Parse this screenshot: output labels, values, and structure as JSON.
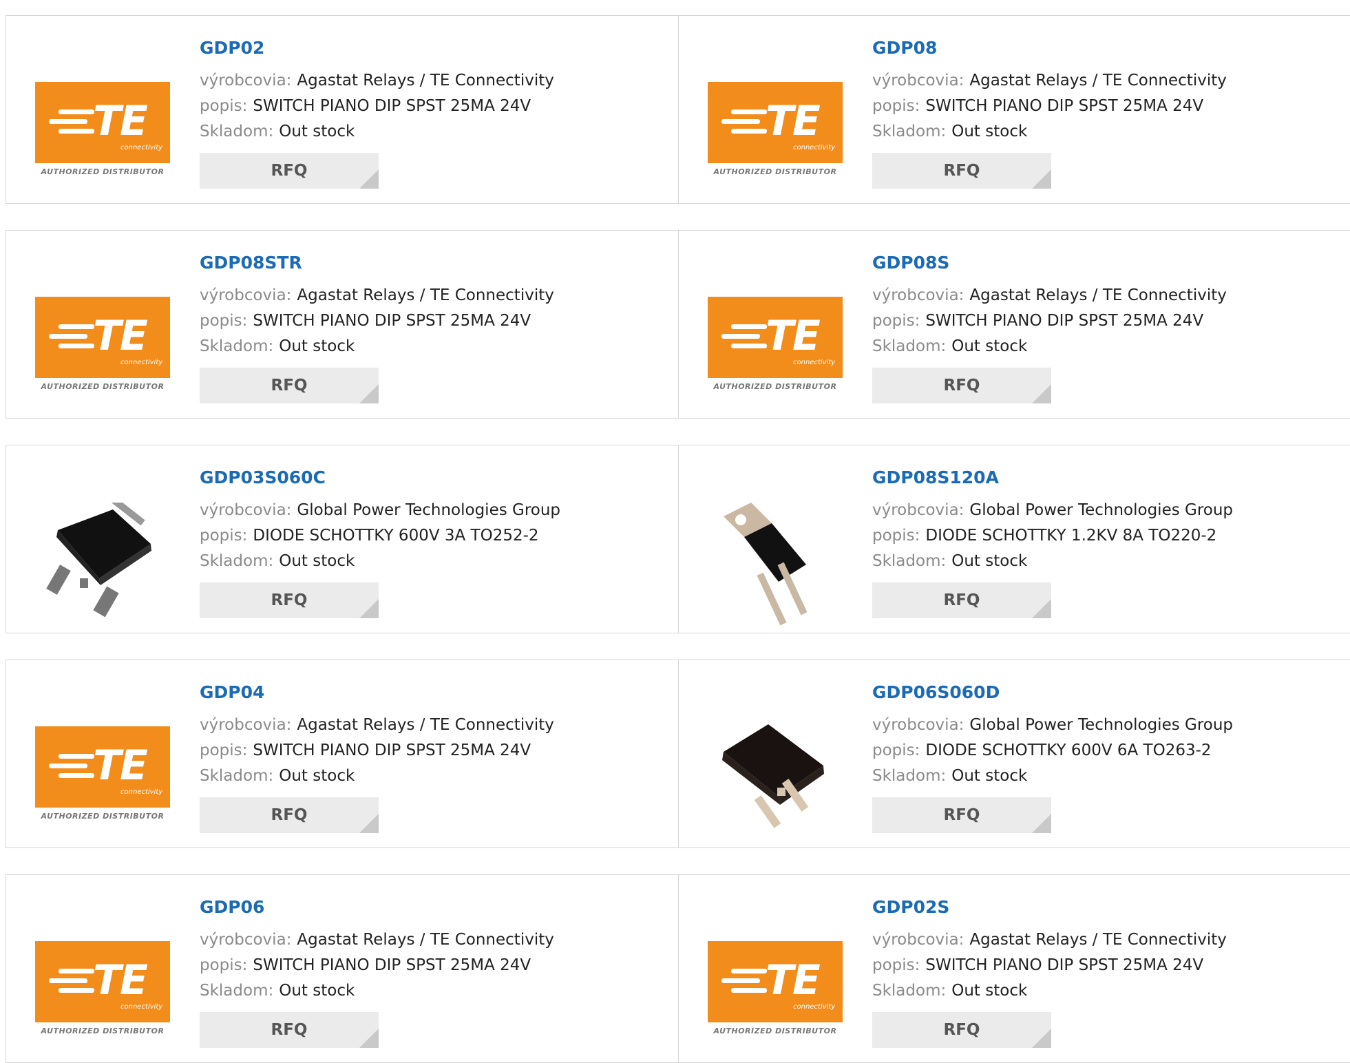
{
  "labels": {
    "manufacturer": "výrobcovia:",
    "description": "popis:",
    "stock": "Skladom:",
    "rfq": "RFQ"
  },
  "logo": {
    "brand_text": "TE",
    "brand_sub": "connectivity",
    "authorized": "AUTHORIZED DISTRIBUTOR",
    "brand_color": "#f28c1a"
  },
  "colors": {
    "link": "#1a6ab5",
    "label": "#8a8a8a",
    "button_bg": "#ebebeb",
    "border": "#d6d6d6"
  },
  "products": [
    {
      "part": "GDP02",
      "manufacturer": "Agastat Relays / TE Connectivity",
      "description": "SWITCH PIANO DIP SPST 25MA 24V",
      "stock": "Out stock",
      "image": "te-logo"
    },
    {
      "part": "GDP08",
      "manufacturer": "Agastat Relays / TE Connectivity",
      "description": "SWITCH PIANO DIP SPST 25MA 24V",
      "stock": "Out stock",
      "image": "te-logo"
    },
    {
      "part": "GDP08STR",
      "manufacturer": "Agastat Relays / TE Connectivity",
      "description": "SWITCH PIANO DIP SPST 25MA 24V",
      "stock": "Out stock",
      "image": "te-logo"
    },
    {
      "part": "GDP08S",
      "manufacturer": "Agastat Relays / TE Connectivity",
      "description": "SWITCH PIANO DIP SPST 25MA 24V",
      "stock": "Out stock",
      "image": "te-logo"
    },
    {
      "part": "GDP03S060C",
      "manufacturer": "Global Power Technologies Group",
      "description": "DIODE SCHOTTKY 600V 3A TO252-2",
      "stock": "Out stock",
      "image": "to252-chip"
    },
    {
      "part": "GDP08S120A",
      "manufacturer": "Global Power Technologies Group",
      "description": "DIODE SCHOTTKY 1.2KV 8A TO220-2",
      "stock": "Out stock",
      "image": "to220-chip"
    },
    {
      "part": "GDP04",
      "manufacturer": "Agastat Relays / TE Connectivity",
      "description": "SWITCH PIANO DIP SPST 25MA 24V",
      "stock": "Out stock",
      "image": "te-logo"
    },
    {
      "part": "GDP06S060D",
      "manufacturer": "Global Power Technologies Group",
      "description": "DIODE SCHOTTKY 600V 6A TO263-2",
      "stock": "Out stock",
      "image": "to263-chip"
    },
    {
      "part": "GDP06",
      "manufacturer": "Agastat Relays / TE Connectivity",
      "description": "SWITCH PIANO DIP SPST 25MA 24V",
      "stock": "Out stock",
      "image": "te-logo"
    },
    {
      "part": "GDP02S",
      "manufacturer": "Agastat Relays / TE Connectivity",
      "description": "SWITCH PIANO DIP SPST 25MA 24V",
      "stock": "Out stock",
      "image": "te-logo"
    }
  ]
}
